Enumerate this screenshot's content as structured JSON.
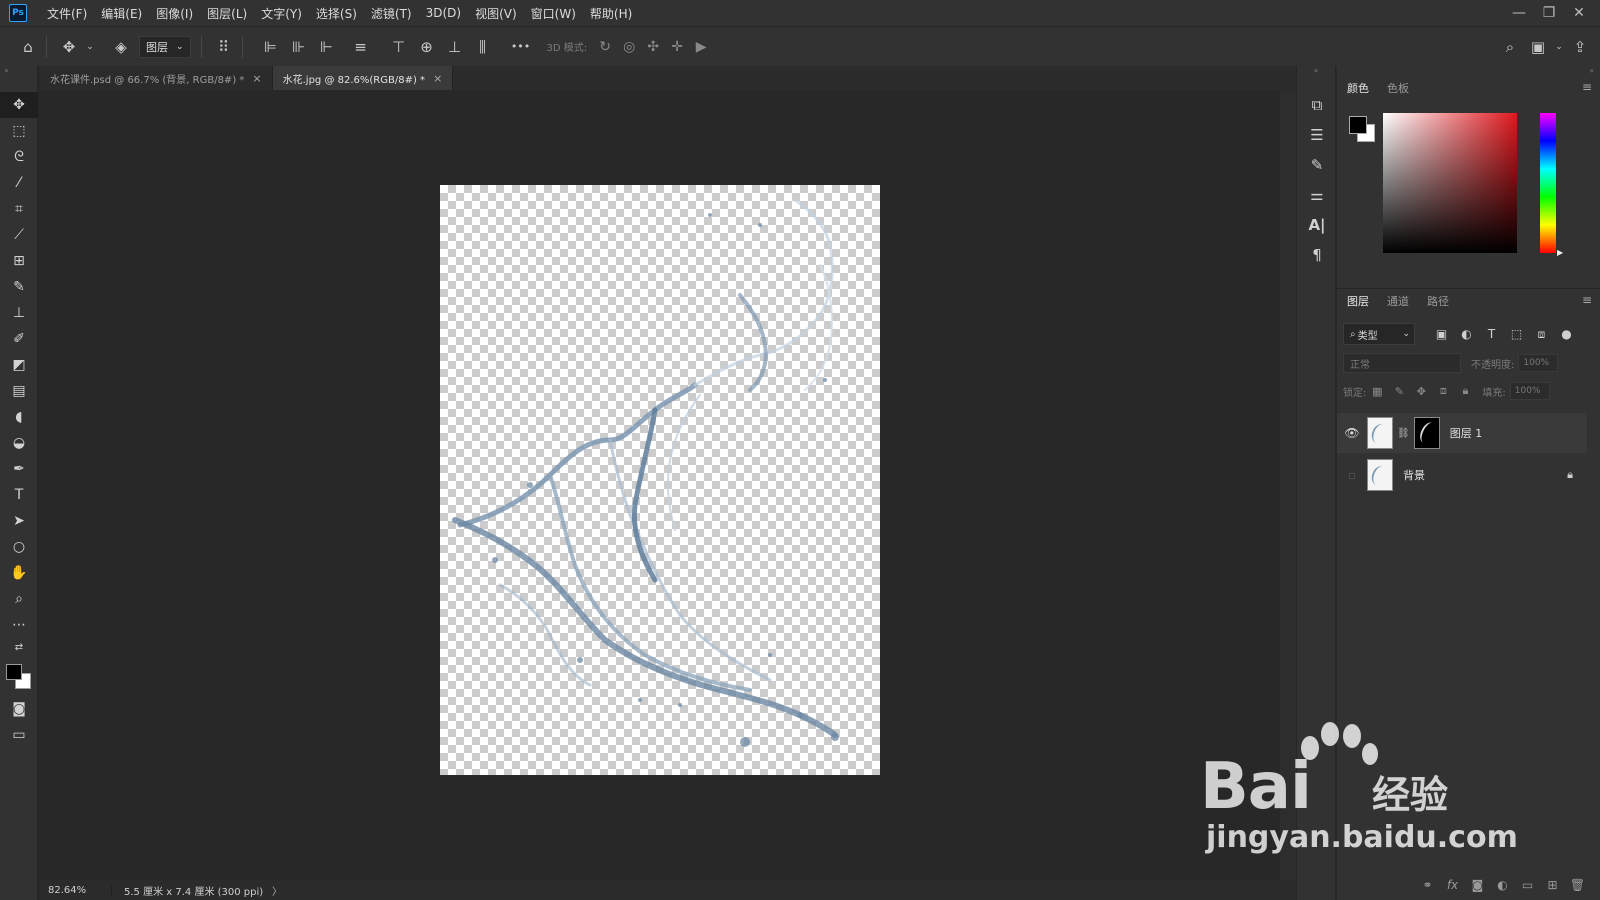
{
  "app": {
    "logo": "Ps"
  },
  "menu": [
    "文件(F)",
    "编辑(E)",
    "图像(I)",
    "图层(L)",
    "文字(Y)",
    "选择(S)",
    "滤镜(T)",
    "3D(D)",
    "视图(V)",
    "窗口(W)",
    "帮助(H)"
  ],
  "window_controls": {
    "minimize": "—",
    "restore": "❐",
    "close": "✕"
  },
  "options": {
    "auto_select_value": "图层",
    "mode_3d_label": "3D 模式:",
    "more_label": "•••"
  },
  "tabs": [
    {
      "label": "水花课件.psd @ 66.7% (背景, RGB/8#) *",
      "close": "×"
    },
    {
      "label": "水花.jpg @ 82.6%(RGB/8#) *",
      "close": "×"
    }
  ],
  "status": {
    "zoom": "82.64%",
    "doc_size": "5.5 厘米 x 7.4 厘米 (300 ppi)",
    "arrow": "〉"
  },
  "color_panel": {
    "tabs": [
      "颜色",
      "色板"
    ]
  },
  "layers_panel": {
    "tabs": [
      "图层",
      "通道",
      "路径"
    ],
    "filter_value": "类型",
    "blend_mode": "正常",
    "opacity_label": "不透明度:",
    "opacity_value": "100%",
    "lock_label": "锁定:",
    "fill_label": "填充:",
    "fill_value": "100%",
    "layers": [
      {
        "name": "图层 1",
        "visible": true,
        "has_mask": true
      },
      {
        "name": "背景",
        "visible": false,
        "locked": true
      }
    ]
  },
  "watermark": {
    "brand": "Bai",
    "brand_cn": "经验",
    "url": "jingyan.baidu.com"
  },
  "colors": {
    "accent": "#2fa3f7",
    "foreground": "#000000",
    "background": "#ffffff"
  }
}
